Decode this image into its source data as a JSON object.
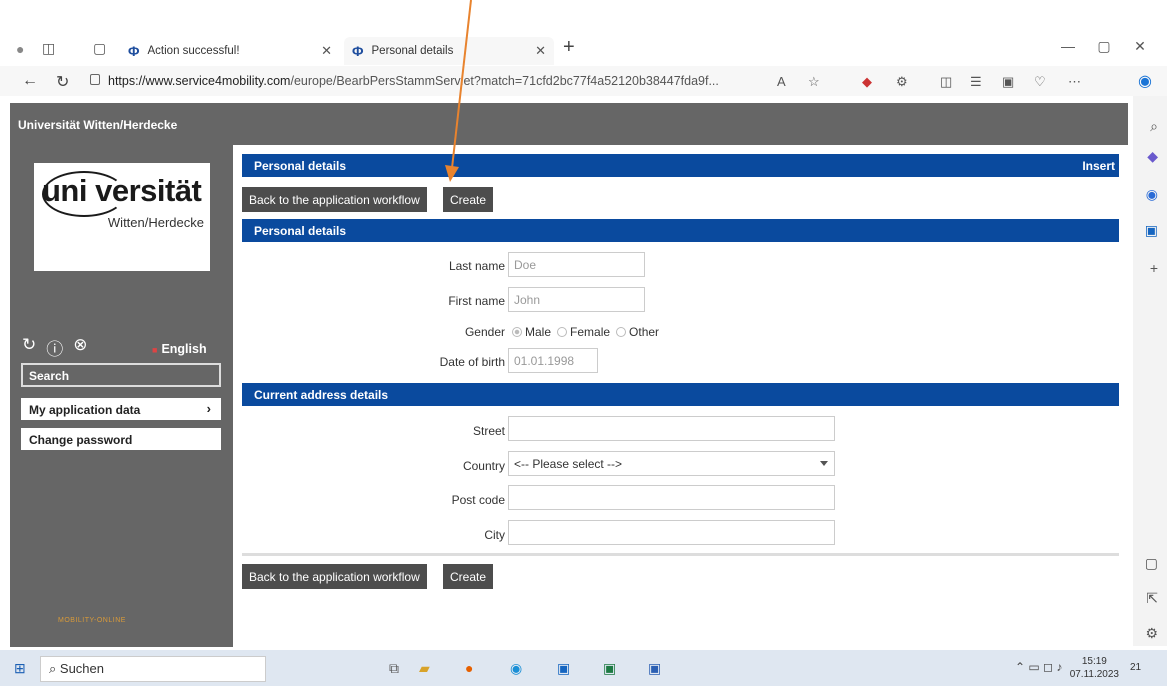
{
  "browser": {
    "tabs": [
      {
        "label": "Action successful!",
        "active": false
      },
      {
        "label": "Personal details",
        "active": true
      }
    ],
    "url_prefix": "https://www.service4mobility.com",
    "url_rest": "/europe/BearbPersStammServlet?match=71cfd2bc77f4a52120b38447fda9f..."
  },
  "page": {
    "header_title": "Universität Witten/Herdecke"
  },
  "sidebar": {
    "logo_text_main": "uni versität",
    "logo_text_sub": "Witten/Herdecke",
    "language": "English",
    "search_label": "Search",
    "items": [
      {
        "label": "My application data"
      },
      {
        "label": "Change password"
      }
    ],
    "footer_logo": "MOBILITY-ONLINE"
  },
  "main": {
    "title_bar": {
      "label": "Personal details",
      "mode": "Insert"
    },
    "buttons": {
      "back": "Back to the application workflow",
      "create": "Create"
    },
    "personal_section": "Personal details",
    "fields": {
      "last_name": {
        "label": "Last name",
        "value": "Doe"
      },
      "first_name": {
        "label": "First name",
        "value": "John"
      },
      "gender": {
        "label": "Gender",
        "options": [
          "Male",
          "Female",
          "Other"
        ],
        "selected": "Male"
      },
      "dob": {
        "label": "Date of birth",
        "value": "01.01.1998"
      }
    },
    "address_section": "Current address details",
    "address": {
      "street": {
        "label": "Street",
        "value": ""
      },
      "country": {
        "label": "Country",
        "value": "<-- Please select -->"
      },
      "post_code": {
        "label": "Post code",
        "value": ""
      },
      "city": {
        "label": "City",
        "value": ""
      }
    }
  },
  "taskbar": {
    "search_placeholder": "Suchen",
    "time": "15:19",
    "date": "07.11.2023",
    "notification_count": "21"
  },
  "colors": {
    "section_bar": "#0a4a9e",
    "button": "#4d4d4d",
    "sidebar": "#666666",
    "annotation_arrow": "#e8832e"
  }
}
